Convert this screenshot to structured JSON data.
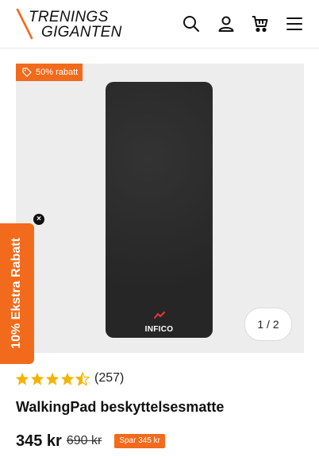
{
  "brand": {
    "line1": "TRENINGS",
    "line2": "GIGANTEN",
    "accent": "#f26a1b"
  },
  "header_icons": [
    "search-icon",
    "account-icon",
    "cart-icon",
    "menu-icon"
  ],
  "gallery": {
    "badge": "50% rabatt",
    "image_logo": "INFICO",
    "pager": "1 / 2"
  },
  "promo_tab": {
    "label": "10% Ekstra Rabatt",
    "close": "×"
  },
  "product": {
    "rating": 4.5,
    "rating_count": "(257)",
    "title": "WalkingPad beskyttelsesmatte",
    "price": "345 kr",
    "old_price": "690 kr",
    "save_label": "Spar 345 kr"
  },
  "colors": {
    "accent": "#f26a1b",
    "star": "#f5b301",
    "mat": "#2b2b2b"
  }
}
